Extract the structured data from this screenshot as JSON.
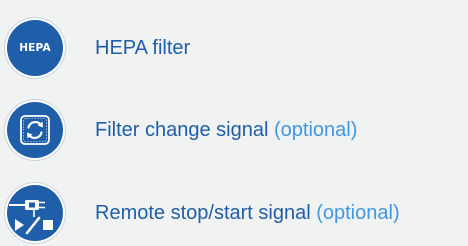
{
  "features": [
    {
      "icon": "hepa-badge-icon",
      "badge_text": "HEPA",
      "label": "HEPA filter",
      "optional_text": ""
    },
    {
      "icon": "filter-change-refresh-icon",
      "label": "Filter change signal",
      "optional_text": "(optional)"
    },
    {
      "icon": "remote-stop-start-icon",
      "label": "Remote stop/start signal",
      "optional_text": "(optional)"
    }
  ],
  "colors": {
    "icon_background": "#1f5ea8",
    "label_text": "#1f5ea8",
    "optional_text": "#3f97e6",
    "page_background": "#f1f2f2"
  }
}
